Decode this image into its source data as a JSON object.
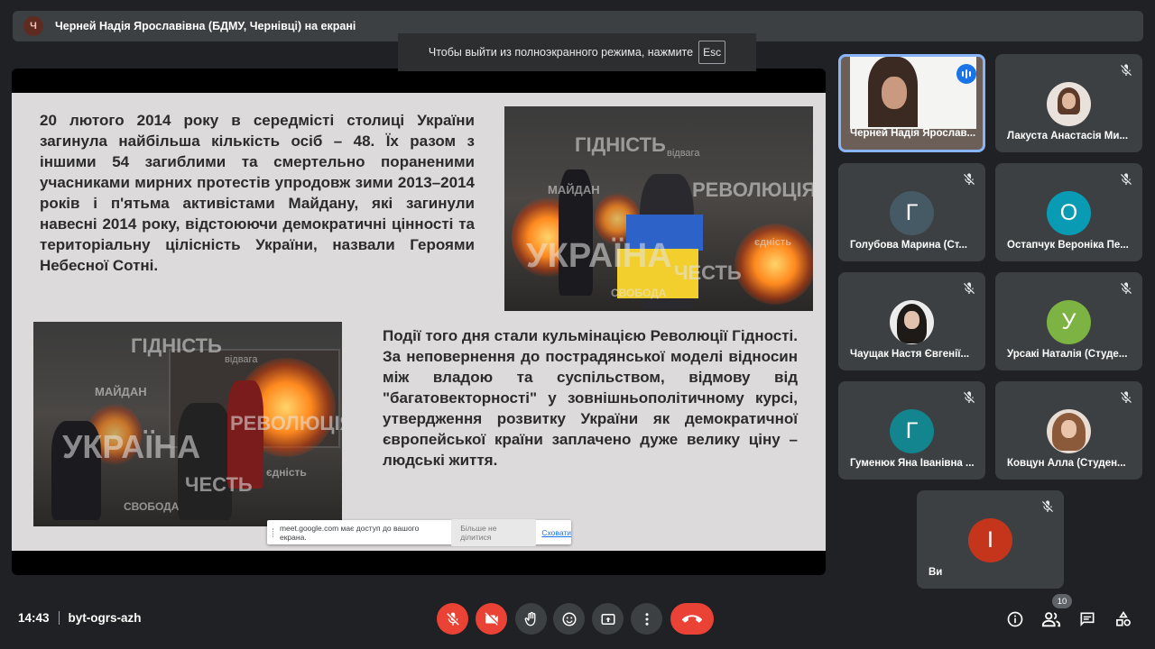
{
  "topbar": {
    "presenter_initial": "Ч",
    "presenter_label": "Черней Надія Ярославівна (БДМУ, Чернівці) на екрані"
  },
  "fullscreen_notice": {
    "text": "Чтобы выйти из полноэкранного режима, нажмите",
    "key": "Esc"
  },
  "slide": {
    "paragraph1": "20 лютого 2014 року в середмісті столиці України загинула найбільша кількість осіб – 48. Їх разом з іншими 54 загиблими та смертельно пораненими учасниками мирних протестів упродовж зими 2013–2014 років і п'ятьма активістами Майдану, які загинули навесні 2014 року, відстоюючи демократичні цінності та територіальну цілісність України, назвали Героями Небесної Сотні.",
    "paragraph2": "Події того дня стали кульмінацією Революції Гідності. За неповернення до пострадянської моделі відносин між владою та суспільством, відмову від \"багатовекторності\" у зовнішньополітичному курсі, утвердження розвитку України як демократичної європейської країни заплачено дуже велику ціну – людські життя.",
    "image_words": {
      "dignity": "ГІДНІСТЬ",
      "courage": "відвага",
      "maidan": "МАЙДАН",
      "revolution": "РЕВОЛЮЦІЯ",
      "ukraine": "УКРАЇНА",
      "honor": "ЧЕСТЬ",
      "unity": "єдність",
      "freedom": "СВОБОДА"
    }
  },
  "share_bar": {
    "message": "meet.google.com має доступ до вашого екрана.",
    "stop_label": "Більше не ділитися",
    "hide_label": "Сховати"
  },
  "participants": [
    {
      "name": "Черней Надія Ярослав...",
      "active": true
    },
    {
      "name": "Лакуста Анастасія Ми..."
    },
    {
      "name": "Голубова Марина (Ст...",
      "initial": "Г"
    },
    {
      "name": "Остапчук Вероніка Пе...",
      "initial": "О"
    },
    {
      "name": "Чаущак Настя Євгенії..."
    },
    {
      "name": "Урсакі Наталія (Студе...",
      "initial": "У"
    },
    {
      "name": "Гуменюк Яна Іванівна ...",
      "initial": "Г"
    },
    {
      "name": "Ковцун Алла (Студен..."
    },
    {
      "name": "Ви",
      "initial": "І"
    }
  ],
  "colors": {
    "avatar_teal": "#12858e",
    "avatar_cyan": "#0a9bb4",
    "avatar_green": "#7cb342",
    "avatar_red": "#c5351b",
    "danger": "#ea4335"
  },
  "bottom": {
    "time": "14:43",
    "meeting_code": "byt-ogrs-azh",
    "participant_count": "10"
  },
  "icons": [
    "mic-off-icon",
    "camera-off-icon",
    "raise-hand-icon",
    "emoji-icon",
    "present-icon",
    "more-icon",
    "end-call-icon",
    "info-icon",
    "people-icon",
    "chat-icon",
    "activities-icon"
  ]
}
